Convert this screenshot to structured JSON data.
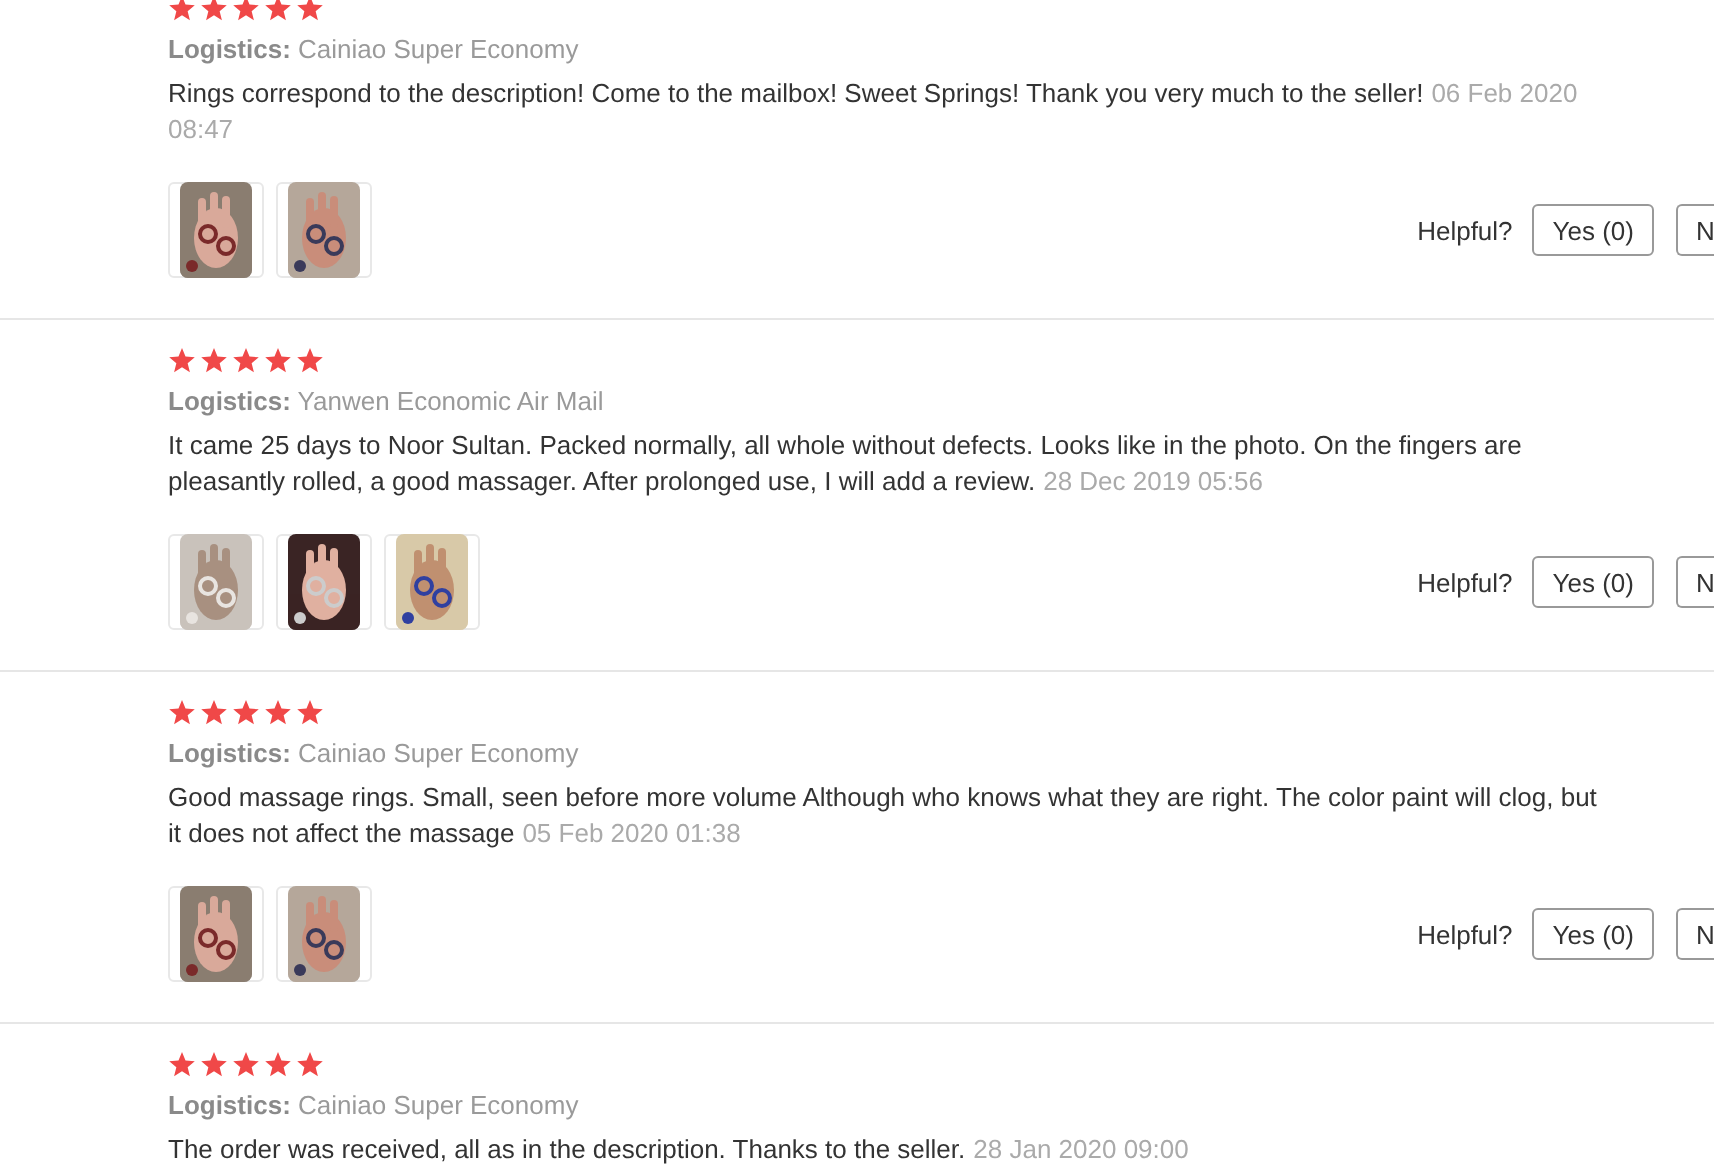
{
  "reviews": [
    {
      "stars": 5,
      "logistics": "**Logistics:** Cainiao Super Economy",
      "text": "Rings correspond to the description! Come to the mailbox! Sweet Springs! Thank you very much to the seller!",
      "date": "06 Feb 2020 08:47",
      "photos": [
        {
          "kind": "picture"
        },
        {
          "kind": "picture"
        }
      ],
      "helpful": "Helpful?",
      "yes_button": "Yes (0)",
      "no_button": "N"
    },
    {
      "stars": 5,
      "logistics": "**Logistics:** Yanwen Economic Air Mail",
      "text": "It came 25 days to Noor Sultan. Packed normally, all whole without defects. Looks like in the photo. On the fingers are pleasantly rolled, a good massager. After prolonged use, I will add a review.",
      "date": "28 Dec 2019 05:56",
      "photos": [
        {
          "kind": "picture"
        },
        {
          "kind": "picture"
        },
        {
          "kind": "picture"
        }
      ],
      "helpful": "Helpful?",
      "yes_button": "Yes (0)",
      "no_button": "N"
    },
    {
      "stars": 5,
      "logistics": "**Logistics:** Cainiao Super Economy",
      "text": "Good massage rings. Small, seen before more volume Although who knows what they are right. The color paint will clog, but it does not affect the massage",
      "date": "05 Feb 2020 01:38",
      "photos": [
        {
          "kind": "picture"
        },
        {
          "kind": "picture"
        }
      ],
      "helpful": "Helpful?",
      "yes_button": "Yes (0)",
      "no_button": "N"
    },
    {
      "stars": 5,
      "logistics": "**Logistics:** Cainiao Super Economy",
      "text": "The order was received, all as in the description. Thanks to the seller.",
      "date": "28 Jan 2020 09:00"
    }
  ]
}
